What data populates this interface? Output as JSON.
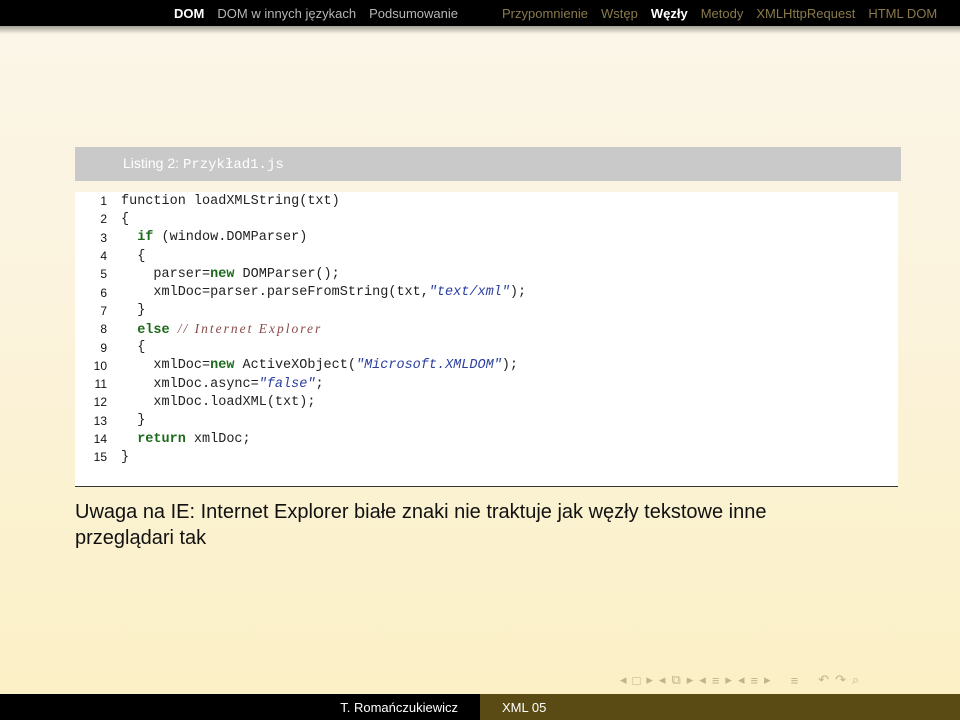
{
  "nav": {
    "sections": [
      "DOM",
      "DOM w innych językach",
      "Podsumowanie"
    ],
    "subsections": [
      "Przypomnienie",
      "Wstęp",
      "Węzły",
      "Metody",
      "XMLHttpRequest",
      "HTML DOM"
    ]
  },
  "listing": {
    "caption_prefix": "Listing 2:",
    "filename": "Przykład1.js"
  },
  "code": {
    "line_numbers": [
      "1",
      "2",
      "3",
      "4",
      "5",
      "6",
      "7",
      "8",
      "9",
      "10",
      "11",
      "12",
      "13",
      "14",
      "15"
    ],
    "lines": [
      [
        {
          "t": "function loadXMLString(txt)",
          "c": ""
        }
      ],
      [
        {
          "t": "{",
          "c": ""
        }
      ],
      [
        {
          "t": "  ",
          "c": ""
        },
        {
          "t": "if",
          "c": "kw"
        },
        {
          "t": " (window.DOMParser)",
          "c": ""
        }
      ],
      [
        {
          "t": "  {",
          "c": ""
        }
      ],
      [
        {
          "t": "    parser=",
          "c": ""
        },
        {
          "t": "new",
          "c": "kw"
        },
        {
          "t": " DOMParser();",
          "c": ""
        }
      ],
      [
        {
          "t": "    xmlDoc=parser.parseFromString(txt,",
          "c": ""
        },
        {
          "t": "\"text/xml\"",
          "c": "str"
        },
        {
          "t": ");",
          "c": ""
        }
      ],
      [
        {
          "t": "  }",
          "c": ""
        }
      ],
      [
        {
          "t": "  ",
          "c": ""
        },
        {
          "t": "else",
          "c": "kw"
        },
        {
          "t": " ",
          "c": ""
        },
        {
          "t": "// Internet Explorer",
          "c": "cmt"
        }
      ],
      [
        {
          "t": "  {",
          "c": ""
        }
      ],
      [
        {
          "t": "    xmlDoc=",
          "c": ""
        },
        {
          "t": "new",
          "c": "kw"
        },
        {
          "t": " ActiveXObject(",
          "c": ""
        },
        {
          "t": "\"Microsoft.XMLDOM\"",
          "c": "str"
        },
        {
          "t": ");",
          "c": ""
        }
      ],
      [
        {
          "t": "    xmlDoc.async=",
          "c": ""
        },
        {
          "t": "\"false\"",
          "c": "str"
        },
        {
          "t": ";",
          "c": ""
        }
      ],
      [
        {
          "t": "    xmlDoc.loadXML(txt);",
          "c": ""
        }
      ],
      [
        {
          "t": "  }",
          "c": ""
        }
      ],
      [
        {
          "t": "  ",
          "c": ""
        },
        {
          "t": "return",
          "c": "kw"
        },
        {
          "t": " xmlDoc;",
          "c": ""
        }
      ],
      [
        {
          "t": "}",
          "c": ""
        }
      ]
    ]
  },
  "note": "Uwaga na IE: Internet Explorer białe znaki nie traktuje jak węzły tekstowe inne przeglądari tak",
  "beamer_icons": [
    "◂",
    "□",
    "▸",
    "◂",
    "⧉",
    "▸",
    "◂",
    "≡",
    "▸",
    "◂",
    "≡",
    "▸",
    "≡",
    "↶",
    "↷",
    "⌕"
  ],
  "footer": {
    "author": "T. Romańczukiewicz",
    "title": "XML 05"
  }
}
